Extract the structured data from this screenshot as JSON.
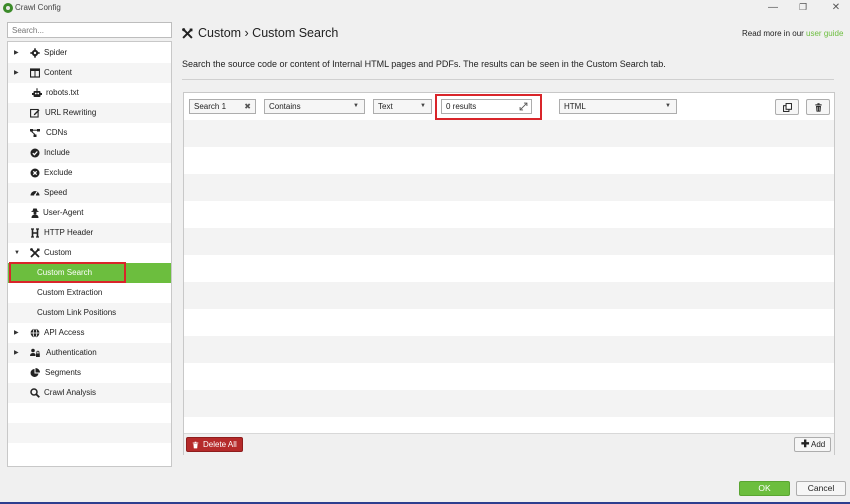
{
  "window": {
    "title": "Crawl Config",
    "minimize": "—",
    "maximize": "❐",
    "close": "✕"
  },
  "sidebar": {
    "search_placeholder": "Search...",
    "items": [
      {
        "label": "Spider",
        "icon": "gear-icon",
        "caret": "▶"
      },
      {
        "label": "Content",
        "icon": "columns-icon",
        "caret": "▶"
      },
      {
        "label": "robots.txt",
        "icon": "robot-icon"
      },
      {
        "label": "URL Rewriting",
        "icon": "edit-icon"
      },
      {
        "label": "CDNs",
        "icon": "network-icon"
      },
      {
        "label": "Include",
        "icon": "check-circle-icon"
      },
      {
        "label": "Exclude",
        "icon": "x-circle-icon"
      },
      {
        "label": "Speed",
        "icon": "speedometer-icon"
      },
      {
        "label": "User-Agent",
        "icon": "user-secret-icon"
      },
      {
        "label": "HTTP Header",
        "icon": "h-icon"
      },
      {
        "label": "Custom",
        "icon": "tools-icon",
        "caret": "▼"
      },
      {
        "label": "Custom Search"
      },
      {
        "label": "Custom Extraction"
      },
      {
        "label": "Custom Link Positions"
      },
      {
        "label": "API Access",
        "icon": "globe-icon",
        "caret": "▶"
      },
      {
        "label": "Authentication",
        "icon": "users-lock-icon",
        "caret": "▶"
      },
      {
        "label": "Segments",
        "icon": "pie-icon"
      },
      {
        "label": "Crawl Analysis",
        "icon": "search-icon"
      }
    ]
  },
  "header": {
    "breadcrumb": "Custom › Custom Search",
    "read_more_prefix": "Read more in our ",
    "read_more_link": "user guide",
    "description": "Search the source code or content of Internal HTML pages and PDFs. The results can be seen in the Custom Search tab."
  },
  "search_row": {
    "name": "Search 1",
    "name_clear": "✖",
    "operator": "Contains",
    "type": "Text",
    "results": "0 results",
    "scope": "HTML",
    "dropdown_arrow": "▼"
  },
  "footer": {
    "delete_all": "Delete All",
    "add": "Add",
    "add_plus": "✚",
    "ok": "OK",
    "cancel": "Cancel"
  },
  "colors": {
    "accent": "#6cbe3e",
    "danger": "#b52a2a",
    "highlight": "#d9252a"
  }
}
